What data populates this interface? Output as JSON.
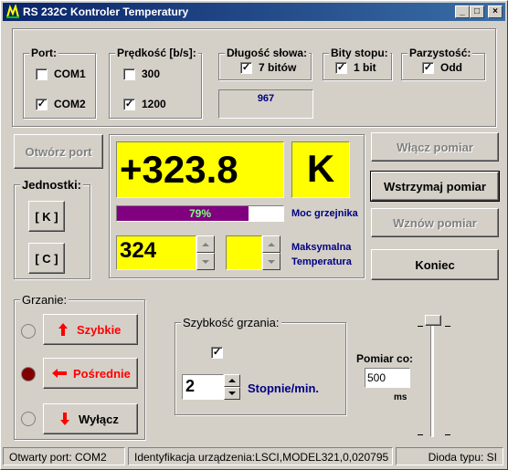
{
  "window": {
    "title": "RS 232C Kontroler Temperatury",
    "min": "_",
    "max": "□",
    "close": "×"
  },
  "port": {
    "legend": "Port:",
    "com1": "COM1",
    "com2": "COM2",
    "com1_checked": false,
    "com2_checked": true
  },
  "speed": {
    "legend": "Prędkość [b/s]:",
    "s300": "300",
    "s1200": "1200",
    "s300_checked": false,
    "s1200_checked": true
  },
  "wordlen": {
    "legend": "Długość słowa:",
    "value": "7 bitów",
    "checked": true
  },
  "stopbits": {
    "legend": "Bity stopu:",
    "value": "1 bit",
    "checked": true
  },
  "parity": {
    "legend": "Parzystość:",
    "value": "Odd",
    "checked": true
  },
  "counter": "967",
  "buttons": {
    "open_port": "Otwórz port",
    "start": "Włącz pomiar",
    "pause": "Wstrzymaj pomiar",
    "resume": "Wznów pomiar",
    "end": "Koniec"
  },
  "display": {
    "temperature": "+323.8",
    "unit": "K"
  },
  "heater": {
    "percent": 79,
    "label": "79%",
    "caption": "Moc grzejnika"
  },
  "units": {
    "legend": "Jednostki:",
    "k": "[ K ]",
    "c": "[ C ]"
  },
  "max_temp": {
    "value": "324",
    "caption_line1": "Maksymalna",
    "caption_line2": "Temperatura"
  },
  "heating": {
    "legend": "Grzanie:",
    "fast": "Szybkie",
    "medium": "Pośrednie",
    "off": "Wyłącz"
  },
  "rate": {
    "legend": "Szybkość grzania:",
    "value": "2",
    "unit": "Stopnie/min.",
    "checked": true
  },
  "measure": {
    "label": "Pomiar co:",
    "value": "500",
    "unit": "ms"
  },
  "status": {
    "port": "Otwarty port: COM2",
    "device": "Identyfikacja urządzenia:LSCI,MODEL321,0,020795",
    "diode": "Dioda typu: SI"
  },
  "colors": {
    "yellow": "#ffff00",
    "purple": "#800080",
    "navy": "#000080",
    "red": "#ff0000",
    "darkred": "#800000"
  }
}
